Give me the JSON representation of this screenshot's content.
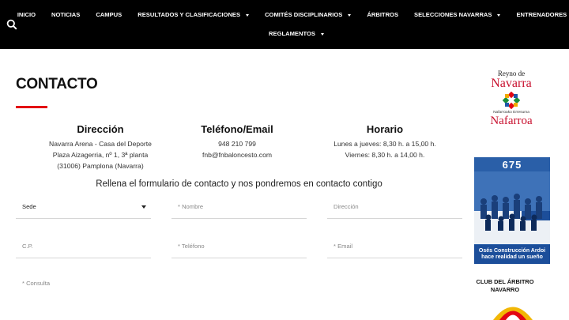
{
  "nav": {
    "row1": [
      {
        "label": "INICIO",
        "dropdown": false
      },
      {
        "label": "NOTICIAS",
        "dropdown": false
      },
      {
        "label": "CAMPUS",
        "dropdown": false
      },
      {
        "label": "RESULTADOS Y CLASIFICACIONES",
        "dropdown": true
      },
      {
        "label": "COMITÉS DISCIPLINARIOS",
        "dropdown": true
      },
      {
        "label": "ÁRBITROS",
        "dropdown": false
      },
      {
        "label": "SELECCIONES NAVARRAS",
        "dropdown": true
      },
      {
        "label": "ENTRENADORES",
        "dropdown": true
      }
    ],
    "row2": [
      {
        "label": "REGLAMENTOS",
        "dropdown": true
      }
    ],
    "search_icon": "search-icon"
  },
  "page": {
    "title": "CONTACTO",
    "accent_color": "#e30613"
  },
  "info": {
    "direccion": {
      "heading": "Dirección",
      "line1": "Navarra Arena - Casa del Deporte",
      "line2": "Plaza Aizagerria, nº 1, 3ª planta",
      "line3": "(31006) Pamplona (Navarra)"
    },
    "telefono": {
      "heading": "Teléfono/Email",
      "phone": "948 210 799",
      "email": "fnb@fnbaloncesto.com"
    },
    "horario": {
      "heading": "Horario",
      "line1": "Lunes a jueves: 8,30 h. a 15,00 h.",
      "line2": "Viernes: 8,30 h. a 14,00 h."
    }
  },
  "form": {
    "intro": "Rellena el formulario de contacto y nos pondremos en contacto contigo",
    "sede": "Sede",
    "nombre": "* Nombre",
    "direccion": "Dirección",
    "cp": "C.P.",
    "telefono": "* Teléfono",
    "email": "* Email",
    "consulta": "* Consulta"
  },
  "sidebar": {
    "navarra": {
      "line1": "Reyno de",
      "line2": "Navarra",
      "line3": "Nafarroako Erresuma",
      "line4": "Nafarroa"
    },
    "banner": {
      "number": "675",
      "footer_line1": "Osés Construcción Ardoi",
      "footer_line2": "hace realidad un sueño"
    },
    "club": {
      "line1": "CLUB DEL ÁRBITRO",
      "line2": "NAVARRO"
    }
  }
}
